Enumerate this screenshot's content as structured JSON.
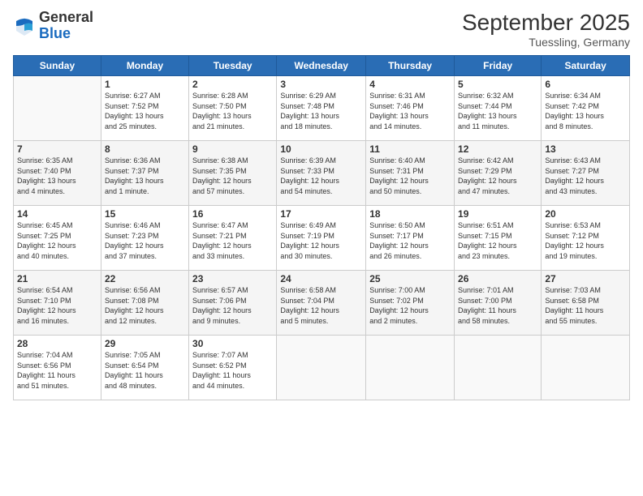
{
  "header": {
    "logo_line1": "General",
    "logo_line2": "Blue",
    "title": "September 2025",
    "location": "Tuessling, Germany"
  },
  "days_of_week": [
    "Sunday",
    "Monday",
    "Tuesday",
    "Wednesday",
    "Thursday",
    "Friday",
    "Saturday"
  ],
  "weeks": [
    [
      {
        "num": "",
        "info": ""
      },
      {
        "num": "1",
        "info": "Sunrise: 6:27 AM\nSunset: 7:52 PM\nDaylight: 13 hours\nand 25 minutes."
      },
      {
        "num": "2",
        "info": "Sunrise: 6:28 AM\nSunset: 7:50 PM\nDaylight: 13 hours\nand 21 minutes."
      },
      {
        "num": "3",
        "info": "Sunrise: 6:29 AM\nSunset: 7:48 PM\nDaylight: 13 hours\nand 18 minutes."
      },
      {
        "num": "4",
        "info": "Sunrise: 6:31 AM\nSunset: 7:46 PM\nDaylight: 13 hours\nand 14 minutes."
      },
      {
        "num": "5",
        "info": "Sunrise: 6:32 AM\nSunset: 7:44 PM\nDaylight: 13 hours\nand 11 minutes."
      },
      {
        "num": "6",
        "info": "Sunrise: 6:34 AM\nSunset: 7:42 PM\nDaylight: 13 hours\nand 8 minutes."
      }
    ],
    [
      {
        "num": "7",
        "info": "Sunrise: 6:35 AM\nSunset: 7:40 PM\nDaylight: 13 hours\nand 4 minutes."
      },
      {
        "num": "8",
        "info": "Sunrise: 6:36 AM\nSunset: 7:37 PM\nDaylight: 13 hours\nand 1 minute."
      },
      {
        "num": "9",
        "info": "Sunrise: 6:38 AM\nSunset: 7:35 PM\nDaylight: 12 hours\nand 57 minutes."
      },
      {
        "num": "10",
        "info": "Sunrise: 6:39 AM\nSunset: 7:33 PM\nDaylight: 12 hours\nand 54 minutes."
      },
      {
        "num": "11",
        "info": "Sunrise: 6:40 AM\nSunset: 7:31 PM\nDaylight: 12 hours\nand 50 minutes."
      },
      {
        "num": "12",
        "info": "Sunrise: 6:42 AM\nSunset: 7:29 PM\nDaylight: 12 hours\nand 47 minutes."
      },
      {
        "num": "13",
        "info": "Sunrise: 6:43 AM\nSunset: 7:27 PM\nDaylight: 12 hours\nand 43 minutes."
      }
    ],
    [
      {
        "num": "14",
        "info": "Sunrise: 6:45 AM\nSunset: 7:25 PM\nDaylight: 12 hours\nand 40 minutes."
      },
      {
        "num": "15",
        "info": "Sunrise: 6:46 AM\nSunset: 7:23 PM\nDaylight: 12 hours\nand 37 minutes."
      },
      {
        "num": "16",
        "info": "Sunrise: 6:47 AM\nSunset: 7:21 PM\nDaylight: 12 hours\nand 33 minutes."
      },
      {
        "num": "17",
        "info": "Sunrise: 6:49 AM\nSunset: 7:19 PM\nDaylight: 12 hours\nand 30 minutes."
      },
      {
        "num": "18",
        "info": "Sunrise: 6:50 AM\nSunset: 7:17 PM\nDaylight: 12 hours\nand 26 minutes."
      },
      {
        "num": "19",
        "info": "Sunrise: 6:51 AM\nSunset: 7:15 PM\nDaylight: 12 hours\nand 23 minutes."
      },
      {
        "num": "20",
        "info": "Sunrise: 6:53 AM\nSunset: 7:12 PM\nDaylight: 12 hours\nand 19 minutes."
      }
    ],
    [
      {
        "num": "21",
        "info": "Sunrise: 6:54 AM\nSunset: 7:10 PM\nDaylight: 12 hours\nand 16 minutes."
      },
      {
        "num": "22",
        "info": "Sunrise: 6:56 AM\nSunset: 7:08 PM\nDaylight: 12 hours\nand 12 minutes."
      },
      {
        "num": "23",
        "info": "Sunrise: 6:57 AM\nSunset: 7:06 PM\nDaylight: 12 hours\nand 9 minutes."
      },
      {
        "num": "24",
        "info": "Sunrise: 6:58 AM\nSunset: 7:04 PM\nDaylight: 12 hours\nand 5 minutes."
      },
      {
        "num": "25",
        "info": "Sunrise: 7:00 AM\nSunset: 7:02 PM\nDaylight: 12 hours\nand 2 minutes."
      },
      {
        "num": "26",
        "info": "Sunrise: 7:01 AM\nSunset: 7:00 PM\nDaylight: 11 hours\nand 58 minutes."
      },
      {
        "num": "27",
        "info": "Sunrise: 7:03 AM\nSunset: 6:58 PM\nDaylight: 11 hours\nand 55 minutes."
      }
    ],
    [
      {
        "num": "28",
        "info": "Sunrise: 7:04 AM\nSunset: 6:56 PM\nDaylight: 11 hours\nand 51 minutes."
      },
      {
        "num": "29",
        "info": "Sunrise: 7:05 AM\nSunset: 6:54 PM\nDaylight: 11 hours\nand 48 minutes."
      },
      {
        "num": "30",
        "info": "Sunrise: 7:07 AM\nSunset: 6:52 PM\nDaylight: 11 hours\nand 44 minutes."
      },
      {
        "num": "",
        "info": ""
      },
      {
        "num": "",
        "info": ""
      },
      {
        "num": "",
        "info": ""
      },
      {
        "num": "",
        "info": ""
      }
    ]
  ]
}
